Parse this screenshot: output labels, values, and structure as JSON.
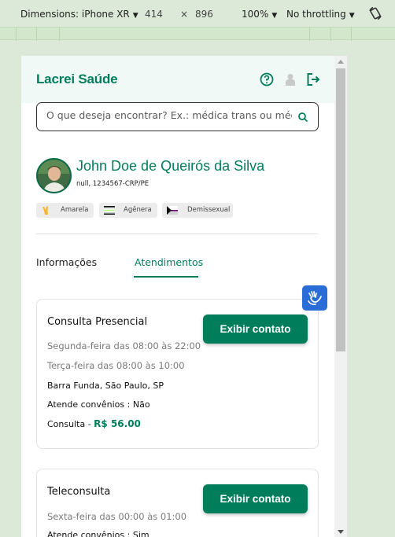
{
  "devtools": {
    "device": "Dimensions: iPhone XR",
    "width": "414",
    "times": "×",
    "height": "896",
    "zoom": "100%",
    "throttling": "No throttling",
    "rotate_icon": "rotate-icon"
  },
  "header": {
    "brand": "Lacrei Saúde",
    "icons": [
      "help-icon",
      "user-icon",
      "logout-icon"
    ]
  },
  "search": {
    "placeholder": "O que deseja encontrar? Ex.: médica trans ou médico gay"
  },
  "profile": {
    "name": "John Doe de Queirós da Silva",
    "registration": "null, 1234567-CRP/PE",
    "tags": [
      {
        "label": "Amarela",
        "icon": "hand-icon"
      },
      {
        "label": "Agênera",
        "icon": "agender-flag-icon"
      },
      {
        "label": "Demissexual",
        "icon": "demisexual-flag-icon"
      }
    ]
  },
  "tabs": [
    {
      "label": "Informações"
    },
    {
      "label": "Atendimentos",
      "active": true
    }
  ],
  "cards": [
    {
      "title": "Consulta Presencial",
      "button": "Exibir contato",
      "schedule": [
        "Segunda-feira das 08:00 às 22:00",
        "Terça-feira das 08:00 às 10:00"
      ],
      "address": "Barra Funda, São Paulo, SP",
      "insurance": "Atende convênios : Não",
      "price_label": "Consulta - ",
      "price_value": "R$ 56.00"
    },
    {
      "title": "Teleconsulta",
      "button": "Exibir contato",
      "schedule": [
        "Sexta-feira das 00:00 às 01:00"
      ],
      "insurance": "Atende convênios : Sim"
    }
  ],
  "colors": {
    "accent": "#007e5c",
    "a11y": "#2a6dd6"
  }
}
